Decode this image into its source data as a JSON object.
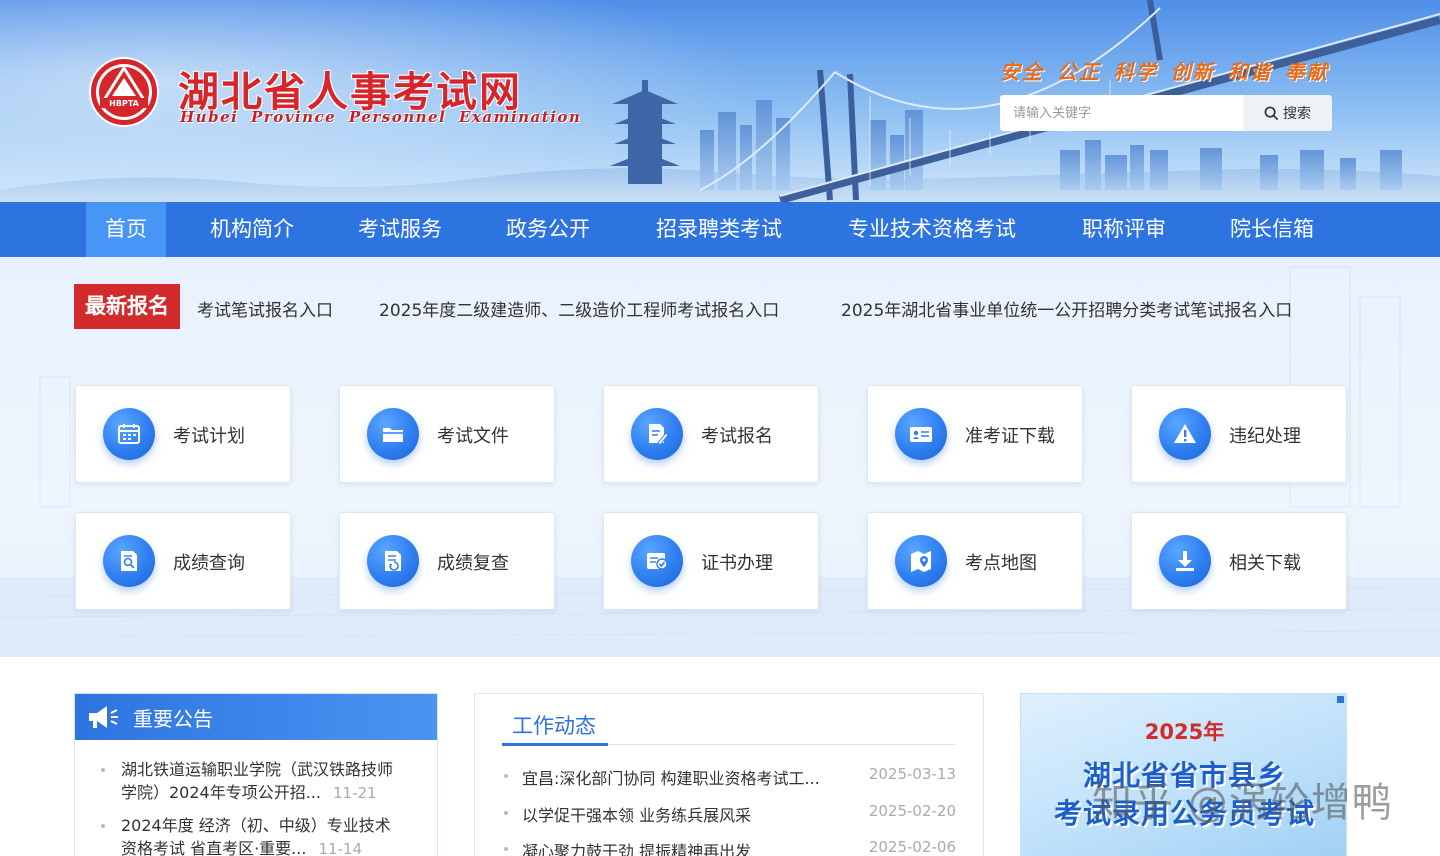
{
  "header": {
    "title": "湖北省人事考试网",
    "subtitle": "Hubei Province Personnel Examination",
    "emblem_text": "HBPTA",
    "slogan": "安全 公正 科学 创新 和谐 奉献",
    "search": {
      "placeholder": "请输入关键字",
      "button_label": "搜索"
    }
  },
  "nav": {
    "items": [
      {
        "label": "首页",
        "active": true
      },
      {
        "label": "机构简介"
      },
      {
        "label": "考试服务"
      },
      {
        "label": "政务公开"
      },
      {
        "label": "招录聘类考试"
      },
      {
        "label": "专业技术资格考试"
      },
      {
        "label": "职称评审"
      },
      {
        "label": "院长信箱"
      }
    ]
  },
  "registration": {
    "label": "最新报名",
    "links": [
      "考试笔试报名入口",
      "2025年度二级建造师、二级造价工程师考试报名入口",
      "2025年湖北省事业单位统一公开招聘分类考试笔试报名入口"
    ]
  },
  "services": [
    {
      "label": "考试计划",
      "icon": "calendar-icon"
    },
    {
      "label": "考试文件",
      "icon": "folder-icon"
    },
    {
      "label": "考试报名",
      "icon": "edit-document-icon"
    },
    {
      "label": "准考证下载",
      "icon": "id-card-icon"
    },
    {
      "label": "违纪处理",
      "icon": "warning-icon"
    },
    {
      "label": "成绩查询",
      "icon": "search-document-icon"
    },
    {
      "label": "成绩复查",
      "icon": "review-document-icon"
    },
    {
      "label": "证书办理",
      "icon": "certificate-icon"
    },
    {
      "label": "考点地图",
      "icon": "map-pin-icon"
    },
    {
      "label": "相关下载",
      "icon": "download-icon"
    }
  ],
  "notices": {
    "title": "重要公告",
    "items": [
      {
        "text_line1": "湖北铁道运输职业学院（武汉铁路技师",
        "text_line2": "学院）2024年专项公开招...",
        "date": "11-21"
      },
      {
        "text_line1": "2024年度 经济（初、中级）专业技术",
        "text_line2": "资格考试 省直考区·重要...",
        "date": "11-14"
      }
    ]
  },
  "work_news": {
    "title": "工作动态",
    "items": [
      {
        "text": "宜昌:深化部门协同 构建职业资格考试工...",
        "date": "2025-03-13"
      },
      {
        "text": "以学促干强本领 业务练兵展风采",
        "date": "2025-02-20"
      },
      {
        "text": "凝心聚力鼓干劲 提振精神再出发",
        "date": "2025-02-06"
      }
    ]
  },
  "promo": {
    "year": "2025年",
    "line1": "湖北省省市县乡",
    "line2": "考试录用公务员考试"
  },
  "watermark": "知乎 @涡轮增鸭",
  "colors": {
    "nav_blue": "#2d74e0",
    "nav_active": "#4795f7",
    "brand_red": "#d12b2b",
    "slogan_orange": "#e96b1c"
  }
}
